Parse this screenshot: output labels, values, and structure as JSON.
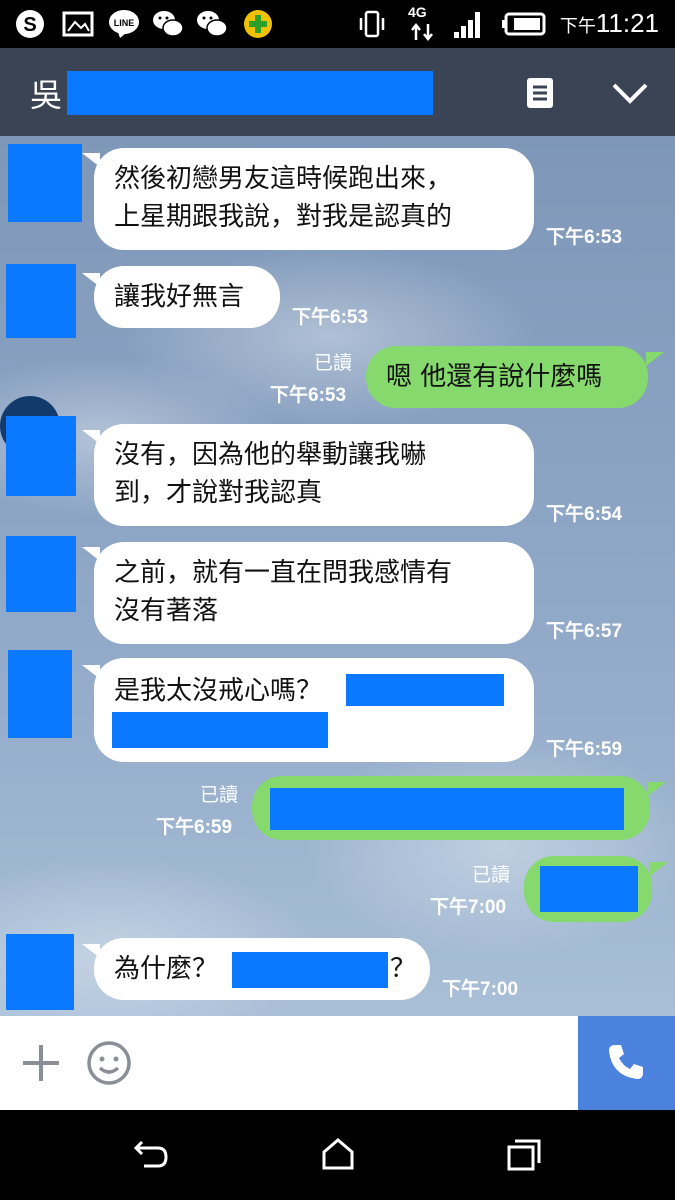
{
  "status_bar": {
    "time_ampm": "下午",
    "time": "11:21",
    "network": "4G",
    "icons": [
      "skype-icon",
      "gallery-icon",
      "line-icon",
      "wechat-icon",
      "wechat-icon",
      "plus-app-icon",
      "vibrate-icon",
      "signal-icon",
      "battery-icon"
    ]
  },
  "header": {
    "name": "吳",
    "menu_icon": "note-icon",
    "collapse_icon": "chevron-down-icon"
  },
  "messages": [
    {
      "dir": "in",
      "lines": [
        "然後初戀男友這時候跑出來，",
        "上星期跟我說，對我是認真的"
      ],
      "time": "下午6:53"
    },
    {
      "dir": "in",
      "lines": [
        "讓我好無言"
      ],
      "time": "下午6:53"
    },
    {
      "dir": "out",
      "lines": [
        "嗯 他還有說什麼嗎"
      ],
      "read": "已讀",
      "time": "下午6:53"
    },
    {
      "dir": "in",
      "lines": [
        "沒有，因為他的舉動讓我嚇",
        "到，才說對我認真"
      ],
      "time": "下午6:54"
    },
    {
      "dir": "in",
      "lines": [
        "之前，就有一直在問我感情有",
        "沒有著落"
      ],
      "time": "下午6:57"
    },
    {
      "dir": "in",
      "lines": [
        "是我太沒戒心嗎？"
      ],
      "time": "下午6:59"
    },
    {
      "dir": "out",
      "lines": [],
      "read": "已讀",
      "time": "下午6:59"
    },
    {
      "dir": "out",
      "lines": [],
      "read": "已讀",
      "time": "下午7:00"
    },
    {
      "dir": "in",
      "lines": [
        "為什麼？",
        "？"
      ],
      "time": "下午7:00"
    }
  ],
  "input_bar": {
    "add_icon": "plus-icon",
    "emoji_icon": "smiley-icon",
    "call_icon": "phone-icon"
  },
  "nav_bar": {
    "icons": [
      "back-icon",
      "home-icon",
      "recents-icon"
    ]
  },
  "colors": {
    "redaction": "#0a78ff",
    "appbar": "#3b4455",
    "outgoing_bubble": "#86d96c",
    "call_button": "#4b82dd"
  }
}
